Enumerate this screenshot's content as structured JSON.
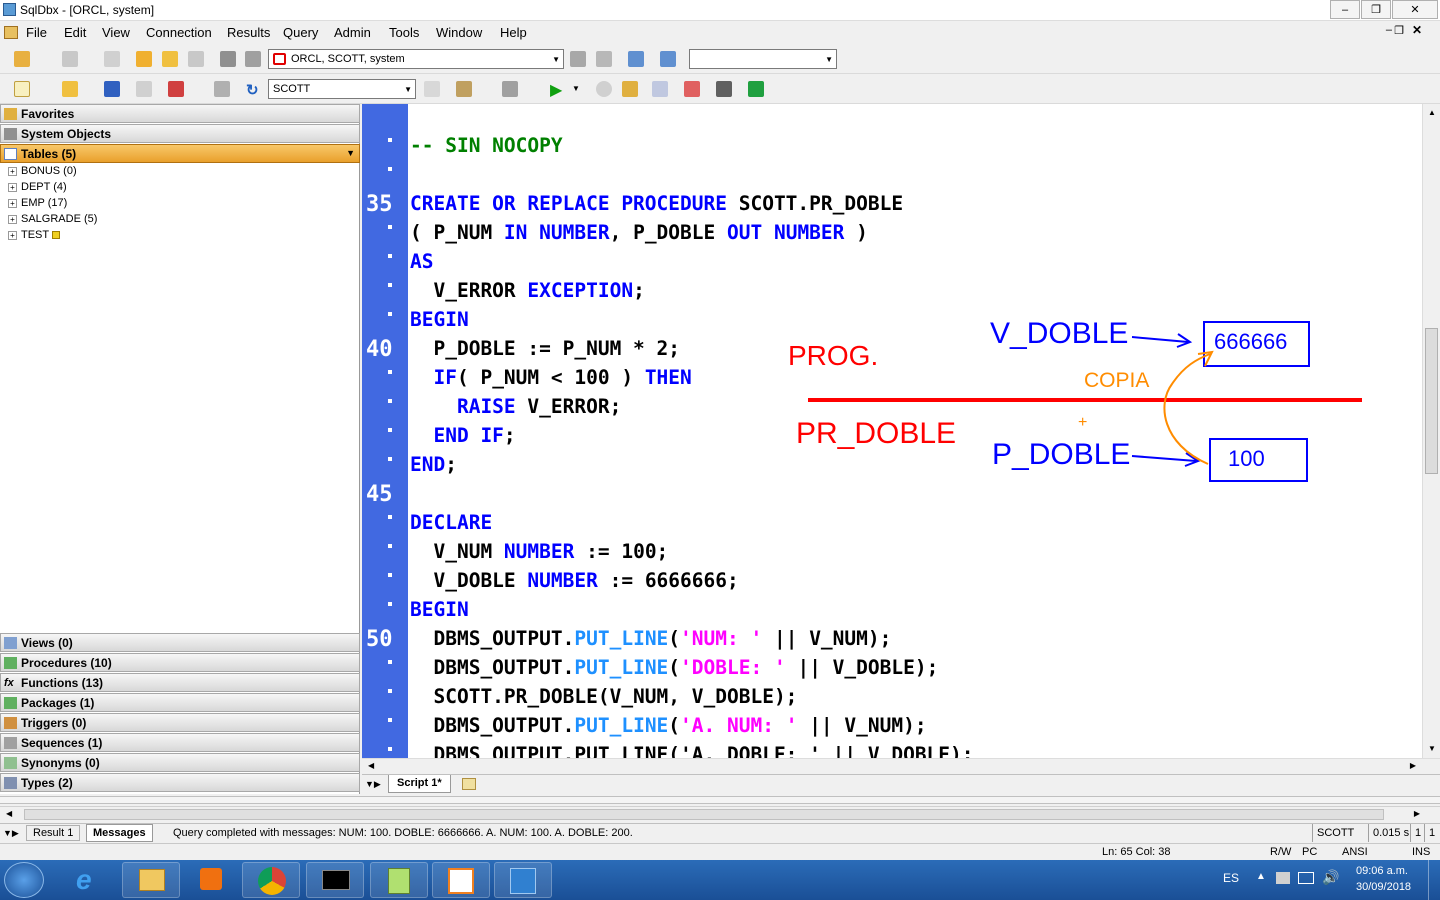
{
  "window": {
    "title": "SqlDbx - [ORCL, system]"
  },
  "menu": {
    "file": "File",
    "edit": "Edit",
    "view": "View",
    "connection": "Connection",
    "results": "Results",
    "query": "Query",
    "admin": "Admin",
    "tools": "Tools",
    "window": "Window",
    "help": "Help"
  },
  "toolbar": {
    "connection": "ORCL, SCOTT, system",
    "schema": "SCOTT"
  },
  "sidebar": {
    "favorites": "Favorites",
    "system_objects": "System Objects",
    "tables": "Tables  (5)",
    "table_items": [
      "BONUS  (0)",
      "DEPT  (4)",
      "EMP  (17)",
      "SALGRADE  (5)",
      "TEST"
    ],
    "views": "Views  (0)",
    "procedures": "Procedures  (10)",
    "functions": "Functions  (13)",
    "packages": "Packages  (1)",
    "triggers": "Triggers  (0)",
    "sequences": "Sequences  (1)",
    "synonyms": "Synonyms  (0)",
    "types": "Types  (2)"
  },
  "editor": {
    "line_numbers": [
      "35",
      "40",
      "45",
      "50"
    ],
    "lines": {
      "l1": "-- SIN NOCOPY",
      "l35a": "CREATE OR REPLACE PROCEDURE",
      "l35b": " SCOTT.PR_DOBLE",
      "l36a": "( P_NUM ",
      "l36b": "IN NUMBER",
      "l36c": ", P_DOBLE ",
      "l36d": "OUT NUMBER",
      "l36e": " )",
      "l37": "AS",
      "l38a": "  V_ERROR ",
      "l38b": "EXCEPTION",
      "l38c": ";",
      "l39": "BEGIN",
      "l40": "  P_DOBLE := P_NUM * 2;",
      "l41a": "  IF",
      "l41b": "( P_NUM < 100 ) ",
      "l41c": "THEN",
      "l42a": "    RAISE",
      "l42b": " V_ERROR;",
      "l43a": "  END IF",
      "l43b": ";",
      "l44a": "END",
      "l44b": ";",
      "l46": "DECLARE",
      "l47a": "  V_NUM ",
      "l47b": "NUMBER",
      "l47c": " := 100;",
      "l48a": "  V_DOBLE ",
      "l48b": "NUMBER",
      "l48c": " := 6666666;",
      "l49": "BEGIN",
      "l50a": "  DBMS_OUTPUT.",
      "l50b": "PUT_LINE",
      "l50c": "(",
      "l50d": "'NUM: '",
      "l50e": " || V_NUM);",
      "l51a": "  DBMS_OUTPUT.",
      "l51b": "PUT_LINE",
      "l51c": "(",
      "l51d": "'DOBLE: '",
      "l51e": " || V_DOBLE);",
      "l52": "  SCOTT.PR_DOBLE(V_NUM, V_DOBLE);",
      "l53a": "  DBMS_OUTPUT.",
      "l53b": "PUT_LINE",
      "l53c": "(",
      "l53d": "'A. NUM: '",
      "l53e": " || V_NUM);",
      "l54": "  DBMS_OUTPUT.PUT_LINE('A. DOBLE: ' || V_DOBLE);"
    }
  },
  "annotation": {
    "prog": "PROG.",
    "pr_doble": "PR_DOBLE",
    "v_doble": "V_DOBLE",
    "p_doble": "P_DOBLE",
    "copia": "COPIA",
    "plus": "+",
    "box_top": "666666",
    "box_bottom": "100",
    "colors": {
      "red": "#ff0000",
      "blue": "#0000ff",
      "orange": "#ff8c00"
    }
  },
  "tabs": {
    "script": "Script 1*"
  },
  "results": {
    "tab_result": "Result 1",
    "tab_messages": "Messages",
    "message": "Query completed with messages: NUM: 100. DOBLE: 6666666. A. NUM: 100. A. DOBLE: 200.",
    "schema": "SCOTT",
    "time": "0.015 s",
    "count": "1",
    "count2": "1"
  },
  "status": {
    "position": "Ln: 65  Col: 38",
    "rw": "R/W",
    "pc": "PC",
    "ansi": "ANSI",
    "ins": "INS"
  },
  "taskbar": {
    "lang": "ES",
    "time": "09:06 a.m.",
    "date": "30/09/2018"
  }
}
